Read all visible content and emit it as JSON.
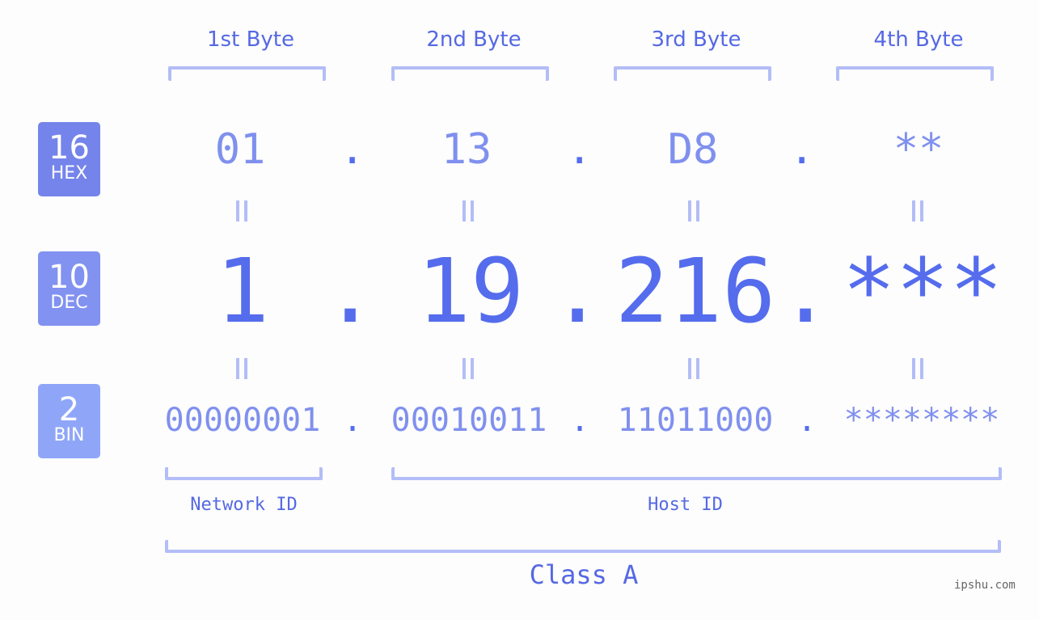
{
  "byte_headers": [
    "1st Byte",
    "2nd Byte",
    "3rd Byte",
    "4th Byte"
  ],
  "badges": [
    {
      "num": "16",
      "label": "HEX",
      "color": "#7584ea"
    },
    {
      "num": "10",
      "label": "DEC",
      "color": "#8292f0"
    },
    {
      "num": "2",
      "label": "BIN",
      "color": "#8fa6f8"
    }
  ],
  "hex": [
    "01",
    "13",
    "D8",
    "**"
  ],
  "dec": [
    "1",
    "19",
    "216",
    "***"
  ],
  "bin": [
    "00000001",
    "00010011",
    "11011000",
    "********"
  ],
  "separator": ".",
  "network_label": "Network ID",
  "host_label": "Host ID",
  "class_label": "Class A",
  "watermark": "ipshu.com",
  "colors": {
    "primary": "#556ced",
    "light": "#8090ee",
    "bracket": "#b3bdf7",
    "background": "#fcfdfc"
  }
}
